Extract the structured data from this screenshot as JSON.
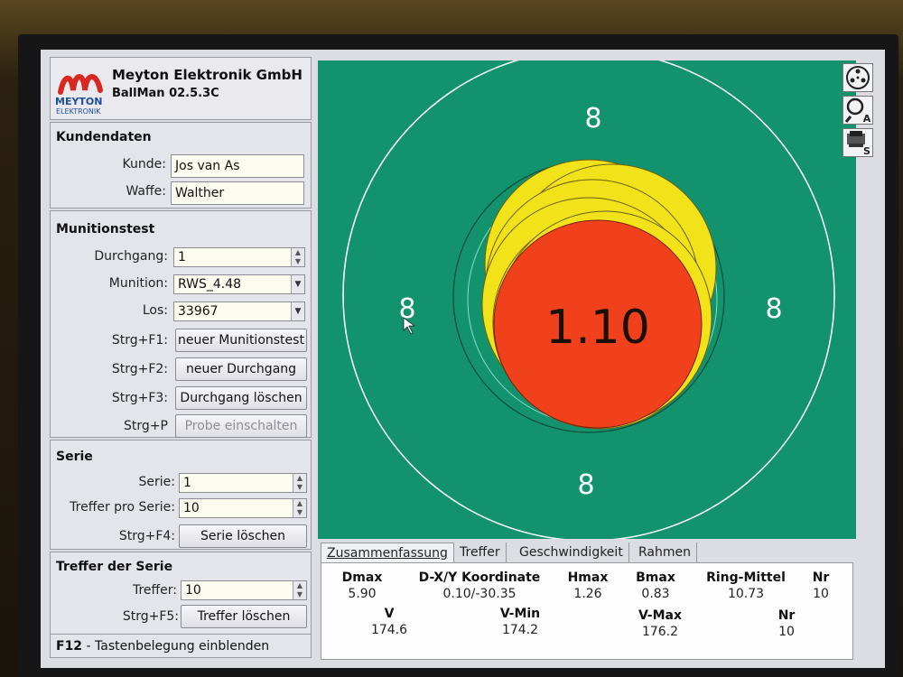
{
  "header": {
    "logo_word": "MEYTON",
    "logo_sub": "ELEKTRONIK",
    "company": "Meyton Elektronik GmbH",
    "version": "BallMan 02.5.3C"
  },
  "customer": {
    "title": "Kundendaten",
    "kunde_label": "Kunde:",
    "kunde_value": "Jos van As",
    "waffe_label": "Waffe:",
    "waffe_value": "Walther"
  },
  "ammo": {
    "title": "Munitionstest",
    "durchgang_label": "Durchgang:",
    "durchgang_value": "1",
    "munition_label": "Munition:",
    "munition_value": "RWS_4.48",
    "los_label": "Los:",
    "los_value": "33967",
    "buttons": [
      {
        "hotkey": "Strg+F1:",
        "label": "neuer Munitionstest",
        "enabled": true
      },
      {
        "hotkey": "Strg+F2:",
        "label": "neuer Durchgang",
        "enabled": true
      },
      {
        "hotkey": "Strg+F3:",
        "label": "Durchgang löschen",
        "enabled": true
      },
      {
        "hotkey": "Strg+P",
        "label": "Probe einschalten",
        "enabled": false
      }
    ]
  },
  "series": {
    "title": "Serie",
    "serie_label": "Serie:",
    "serie_value": "1",
    "treffer_label": "Treffer pro Serie:",
    "treffer_value": "10",
    "hotkey": "Strg+F4:",
    "button": "Serie löschen"
  },
  "hits": {
    "title": "Treffer der Serie",
    "treffer_label": "Treffer:",
    "treffer_value": "10",
    "hotkey": "Strg+F5:",
    "button": "Treffer löschen"
  },
  "footer": {
    "key": "F12",
    "text": "- Tastenbelegung einblenden"
  },
  "target": {
    "center_value": "1.10",
    "ring_number": "8",
    "background_color": "#13936d",
    "hit_color": "#f2e21a",
    "last_hit_color": "#f0401c"
  },
  "tools": {
    "icons": [
      "target-view-icon",
      "zoom-a-icon",
      "print-s-icon"
    ],
    "zoom_letter": "A",
    "print_letter": "S"
  },
  "tabs": [
    "Zusammenfassung",
    "Treffer",
    "Geschwindigkeit",
    "Rahmen"
  ],
  "summary": {
    "row1_headers": [
      "Dmax",
      "D-X/Y Koordinate",
      "Hmax",
      "Bmax",
      "Ring-Mittel",
      "Nr"
    ],
    "row1_values": [
      "5.90",
      "0.10/-30.35",
      "1.26",
      "0.83",
      "10.73",
      "10"
    ],
    "row2_headers": [
      "V",
      "V-Min",
      "V-Max",
      "Nr"
    ],
    "row2_values": [
      "174.6",
      "174.2",
      "176.2",
      "10"
    ]
  }
}
